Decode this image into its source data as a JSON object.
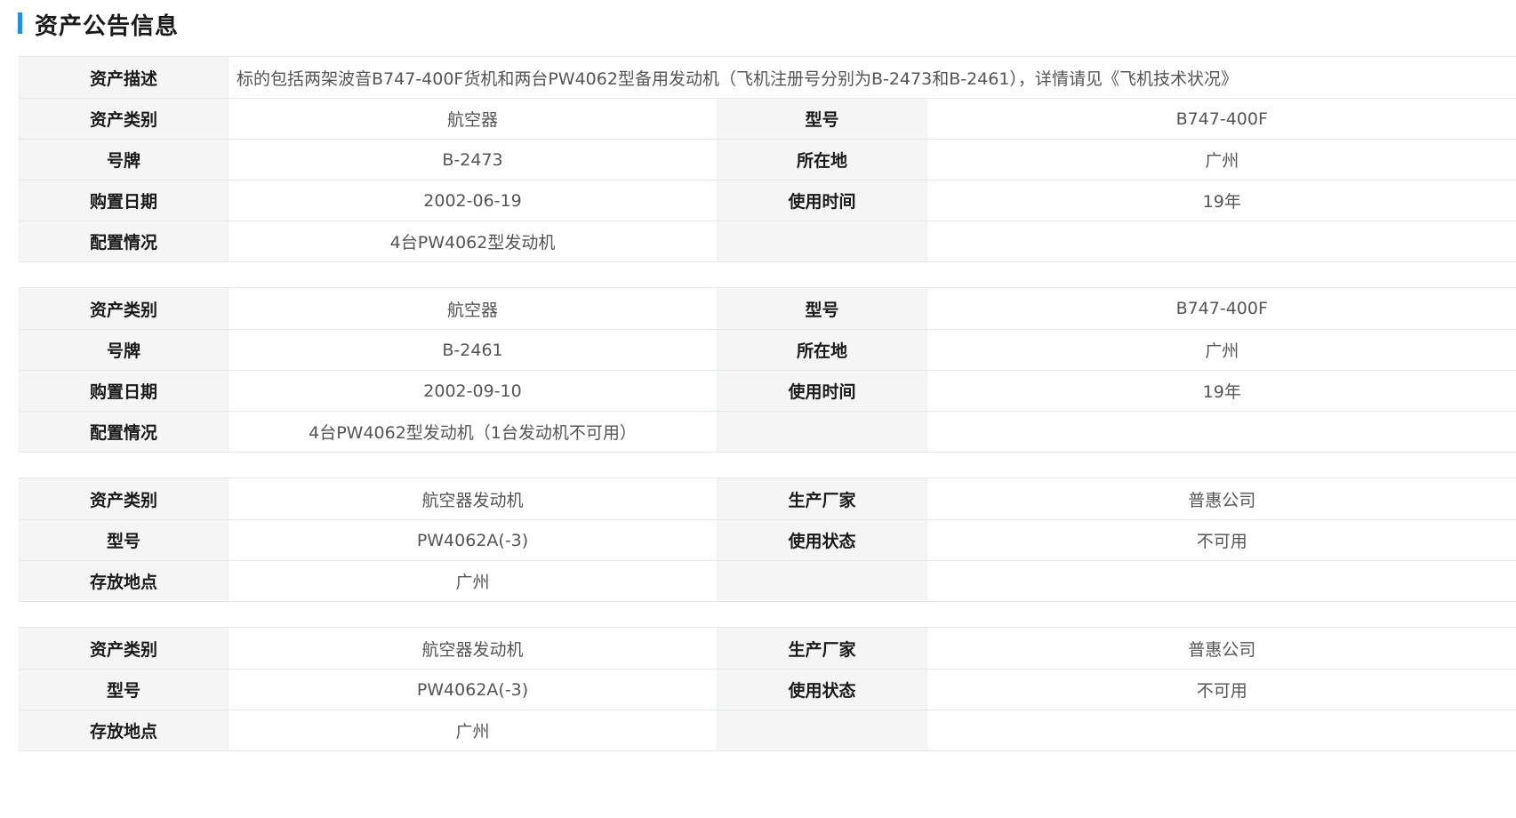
{
  "section": {
    "title": "资产公告信息",
    "accent_color": "#1e90e6"
  },
  "description": {
    "label": "资产描述",
    "value": "标的包括两架波音B747-400F货机和两台PW4062型备用发动机（飞机注册号分别为B-2473和B-2461），详情请见《飞机技术状况》"
  },
  "assets": [
    {
      "rows": [
        {
          "label1": "资产类别",
          "value1": "航空器",
          "label2": "型号",
          "value2": "B747-400F"
        },
        {
          "label1": "号牌",
          "value1": "B-2473",
          "label2": "所在地",
          "value2": "广州"
        },
        {
          "label1": "购置日期",
          "value1": "2002-06-19",
          "label2": "使用时间",
          "value2": "19年"
        },
        {
          "label1": "配置情况",
          "value1": "4台PW4062型发动机",
          "label2": "",
          "value2": ""
        }
      ]
    },
    {
      "rows": [
        {
          "label1": "资产类别",
          "value1": "航空器",
          "label2": "型号",
          "value2": "B747-400F"
        },
        {
          "label1": "号牌",
          "value1": "B-2461",
          "label2": "所在地",
          "value2": "广州"
        },
        {
          "label1": "购置日期",
          "value1": "2002-09-10",
          "label2": "使用时间",
          "value2": "19年"
        },
        {
          "label1": "配置情况",
          "value1": "4台PW4062型发动机（1台发动机不可用）",
          "label2": "",
          "value2": ""
        }
      ]
    },
    {
      "rows": [
        {
          "label1": "资产类别",
          "value1": "航空器发动机",
          "label2": "生产厂家",
          "value2": "普惠公司"
        },
        {
          "label1": "型号",
          "value1": "PW4062A(-3)",
          "label2": "使用状态",
          "value2": "不可用"
        },
        {
          "label1": "存放地点",
          "value1": "广州",
          "label2": "",
          "value2": ""
        }
      ]
    },
    {
      "rows": [
        {
          "label1": "资产类别",
          "value1": "航空器发动机",
          "label2": "生产厂家",
          "value2": "普惠公司"
        },
        {
          "label1": "型号",
          "value1": "PW4062A(-3)",
          "label2": "使用状态",
          "value2": "不可用"
        },
        {
          "label1": "存放地点",
          "value1": "广州",
          "label2": "",
          "value2": ""
        }
      ]
    }
  ]
}
